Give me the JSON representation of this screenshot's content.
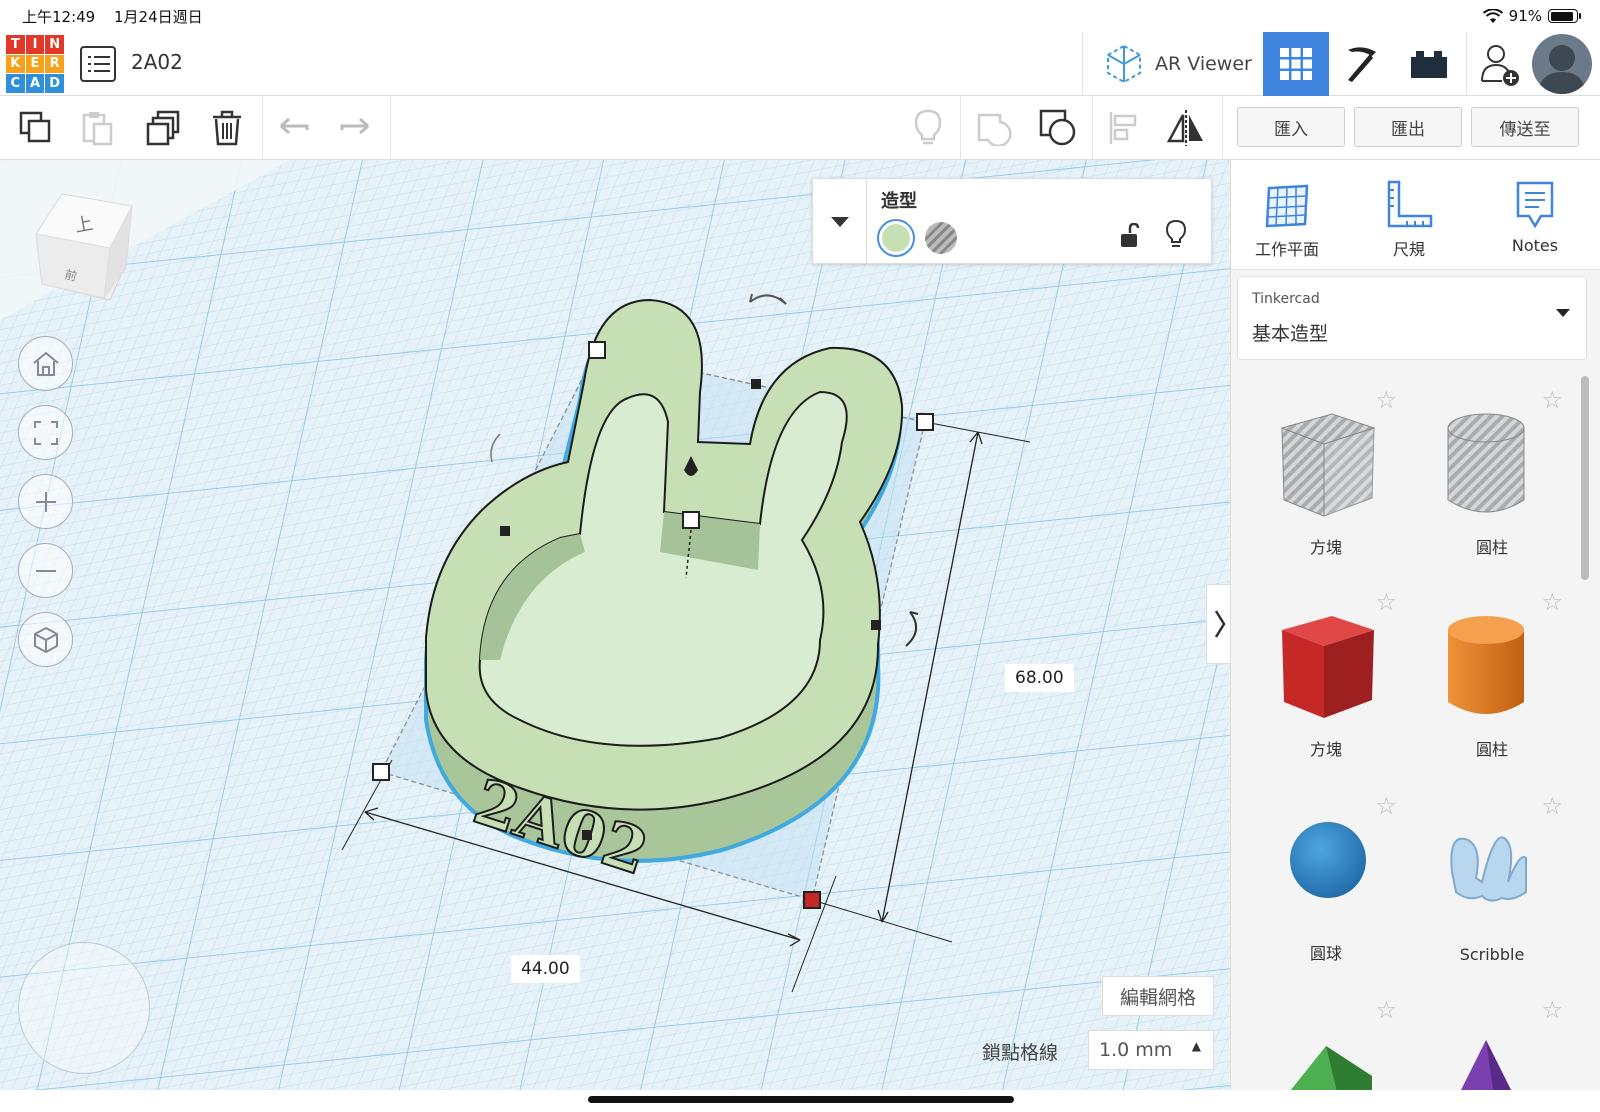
{
  "status": {
    "time": "上午12:49",
    "date": "1月24日週日",
    "battery": "91%",
    "battery_level": 0.91
  },
  "logo": [
    "T",
    "I",
    "N",
    "K",
    "E",
    "R",
    "C",
    "A",
    "D"
  ],
  "logo_colors": [
    "#e2372b",
    "#e2372b",
    "#e2372b",
    "#f7a11a",
    "#f7a11a",
    "#f7a11a",
    "#2f8fd8",
    "#2f8fd8",
    "#2f8fd8"
  ],
  "project": {
    "title": "2A02"
  },
  "top_actions": {
    "ar_viewer": "AR Viewer"
  },
  "toolbar": {
    "import": "匯入",
    "export": "匯出",
    "send_to": "傳送至"
  },
  "shape_panel": {
    "title": "造型",
    "solid_color": "#c6dfb5"
  },
  "view_cube": {
    "top": "上",
    "front": "前"
  },
  "dimensions": {
    "length": "68.00",
    "width": "44.00"
  },
  "model_text": "2A02",
  "grid": {
    "edit_grid": "編輯網格",
    "snap_label": "鎖點格線",
    "snap_value": "1.0 mm"
  },
  "sidebar": {
    "tools": [
      {
        "label": "工作平面",
        "icon": "workplane-icon"
      },
      {
        "label": "尺規",
        "icon": "ruler-icon"
      },
      {
        "label": "Notes",
        "icon": "notes-icon"
      }
    ],
    "library": {
      "source": "Tinkercad",
      "name": "基本造型"
    },
    "shapes": [
      {
        "label": "方塊",
        "icon": "box-hole-icon"
      },
      {
        "label": "圓柱",
        "icon": "cylinder-hole-icon"
      },
      {
        "label": "方塊",
        "icon": "box-icon"
      },
      {
        "label": "圓柱",
        "icon": "cylinder-icon"
      },
      {
        "label": "圓球",
        "icon": "sphere-icon"
      },
      {
        "label": "Scribble",
        "icon": "scribble-icon"
      }
    ]
  },
  "colors": {
    "accent": "#3f84de",
    "model": "#c6dfb5",
    "outline": "#3fa9e0",
    "red_box": "#c62828",
    "orange_cyl": "#e07a1a",
    "sphere": "#2e86c8",
    "pyramid_green": "#4caf50",
    "cone_purple": "#7b3fb0"
  }
}
